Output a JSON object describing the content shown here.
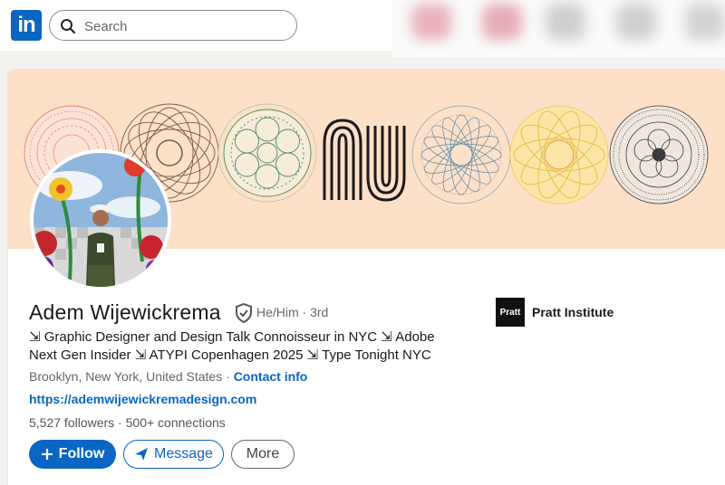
{
  "nav": {
    "logo_text": "in",
    "search_placeholder": "Search"
  },
  "profile": {
    "name": "Adem Wijewickrema",
    "pronouns": "He/Him · 3rd",
    "headline": "⇲ Graphic Designer and Design Talk Connoisseur in NYC ⇲ Adobe Next Gen Insider ⇲ ATYPI Copenhagen 2025 ⇲ Type Tonight NYC",
    "location": "Brooklyn, New York, United States",
    "location_sep": " · ",
    "contact_info": "Contact info",
    "website": "https://ademwijewickremadesign.com",
    "followers": "5,527 followers",
    "connections": "500+ connections",
    "education": {
      "logo_text": "Pratt",
      "name": "Pratt Institute"
    }
  },
  "actions": {
    "follow": "Follow",
    "message": "Message",
    "more": "More"
  },
  "colors": {
    "brand": "#0a66c2",
    "banner": "#fde0c8"
  },
  "icons": {
    "search": "search-icon",
    "verify": "verified-shield-icon",
    "plus": "plus-icon",
    "send": "paper-plane-icon"
  }
}
